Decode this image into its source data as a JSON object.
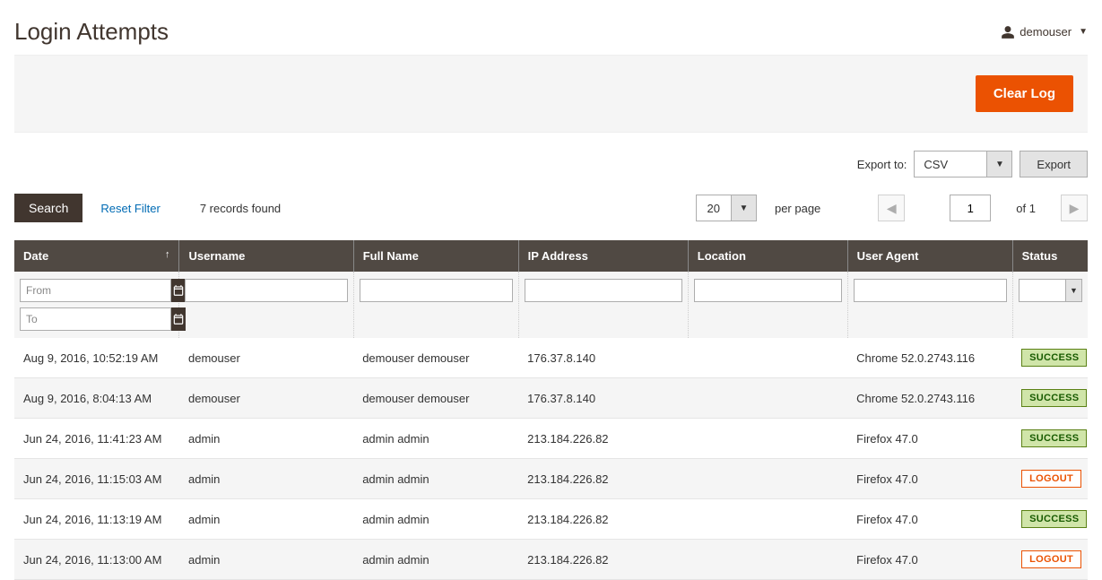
{
  "header": {
    "title": "Login Attempts",
    "user": "demouser"
  },
  "actions": {
    "clear_log": "Clear Log"
  },
  "export": {
    "label": "Export to:",
    "selected": "CSV",
    "button": "Export"
  },
  "toolbar": {
    "search": "Search",
    "reset": "Reset Filter",
    "records_found": "7 records found",
    "per_page_value": "20",
    "per_page_label": "per page",
    "current_page": "1",
    "of_label": "of",
    "total_pages": "1"
  },
  "filters": {
    "from_placeholder": "From",
    "to_placeholder": "To"
  },
  "columns": [
    "Date",
    "Username",
    "Full Name",
    "IP Address",
    "Location",
    "User Agent",
    "Status"
  ],
  "rows": [
    {
      "date": "Aug 9, 2016, 10:52:19 AM",
      "username": "demouser",
      "fullname": "demouser demouser",
      "ip": "176.37.8.140",
      "location": "",
      "agent": "Chrome 52.0.2743.116",
      "status_label": "SUCCESS",
      "status_kind": "success"
    },
    {
      "date": "Aug 9, 2016, 8:04:13 AM",
      "username": "demouser",
      "fullname": "demouser demouser",
      "ip": "176.37.8.140",
      "location": "",
      "agent": "Chrome 52.0.2743.116",
      "status_label": "SUCCESS",
      "status_kind": "success"
    },
    {
      "date": "Jun 24, 2016, 11:41:23 AM",
      "username": "admin",
      "fullname": "admin admin",
      "ip": "213.184.226.82",
      "location": "",
      "agent": "Firefox 47.0",
      "status_label": "SUCCESS",
      "status_kind": "success"
    },
    {
      "date": "Jun 24, 2016, 11:15:03 AM",
      "username": "admin",
      "fullname": "admin admin",
      "ip": "213.184.226.82",
      "location": "",
      "agent": "Firefox 47.0",
      "status_label": "LOGOUT",
      "status_kind": "logout"
    },
    {
      "date": "Jun 24, 2016, 11:13:19 AM",
      "username": "admin",
      "fullname": "admin admin",
      "ip": "213.184.226.82",
      "location": "",
      "agent": "Firefox 47.0",
      "status_label": "SUCCESS",
      "status_kind": "success"
    },
    {
      "date": "Jun 24, 2016, 11:13:00 AM",
      "username": "admin",
      "fullname": "admin admin",
      "ip": "213.184.226.82",
      "location": "",
      "agent": "Firefox 47.0",
      "status_label": "LOGOUT",
      "status_kind": "logout"
    }
  ]
}
